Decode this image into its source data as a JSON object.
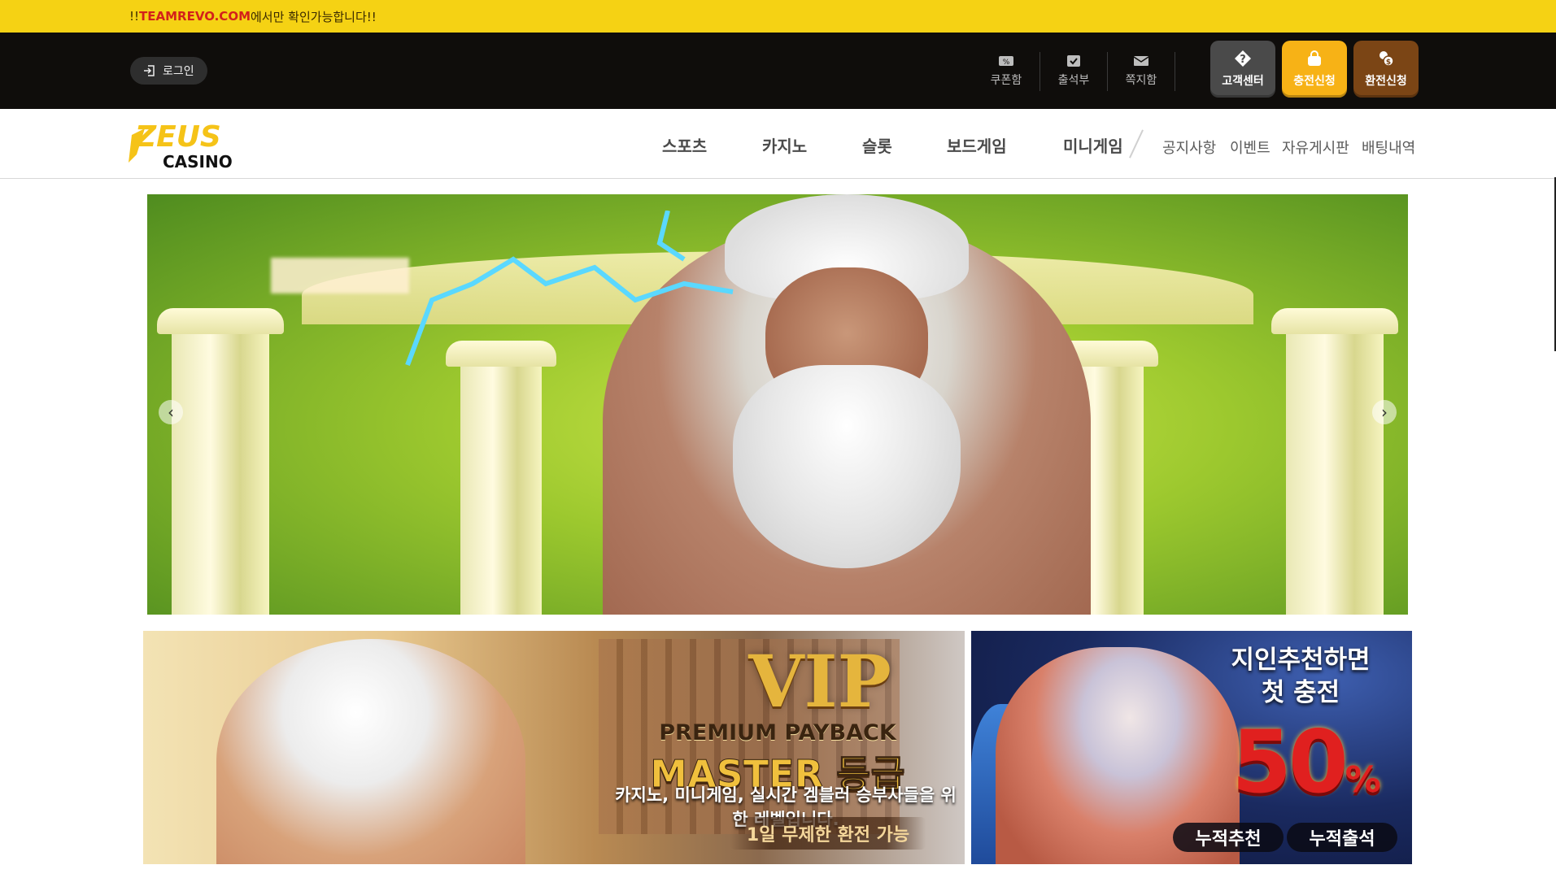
{
  "notice": {
    "prefix": "!!",
    "highlight": "TEAMREVO.COM",
    "suffix": "에서만 확인가능합니다!!"
  },
  "topbar": {
    "login_label": "로그인",
    "utilities": [
      {
        "label": "쿠폰함",
        "icon": "coupon-icon"
      },
      {
        "label": "출석부",
        "icon": "attendance-icon"
      },
      {
        "label": "쪽지함",
        "icon": "message-icon"
      }
    ],
    "actions": [
      {
        "label": "고객센터",
        "icon": "question-icon",
        "color": "#4a4a4a"
      },
      {
        "label": "충전신청",
        "icon": "bag-icon",
        "color": "#f7b216"
      },
      {
        "label": "환전신청",
        "icon": "coins-icon",
        "color": "#7b4515"
      }
    ]
  },
  "logo": {
    "word": "ZEUS",
    "sub": "CASINO",
    "color": "#f5c318"
  },
  "nav": {
    "main": [
      "스포츠",
      "카지노",
      "슬롯",
      "보드게임",
      "미니게임"
    ],
    "sub": [
      "공지사항",
      "이벤트",
      "자유게시판",
      "배팅내역"
    ]
  },
  "hero": {
    "prev_icon": "chevron-left-icon",
    "next_icon": "chevron-right-icon",
    "prev_glyph": "‹",
    "next_glyph": "›"
  },
  "promos": {
    "vip": {
      "title": "VIP",
      "subtitle": "PREMIUM PAYBACK",
      "grade": "MASTER 등급",
      "description": "카지노, 미니게임, 실시간 겜블러 승부사들을 위한 레벨입니다.",
      "pill": "1일 무제한 환전 가능"
    },
    "referral": {
      "line1": "지인추천하면",
      "line2": "첫 충전",
      "percent": "50",
      "percent_sign": "%",
      "pill_left": "누적추천",
      "pill_right": "누적출석"
    }
  }
}
